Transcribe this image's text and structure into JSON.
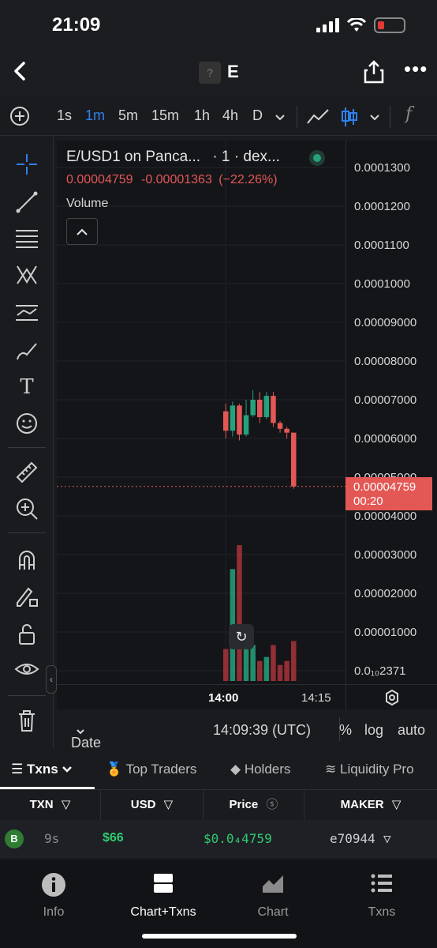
{
  "status_bar": {
    "time": "21:09"
  },
  "header": {
    "token_symbol": "E",
    "token_logo_placeholder": "?"
  },
  "toolbar": {
    "intervals": [
      "1s",
      "1m",
      "5m",
      "15m",
      "1h",
      "4h",
      "D"
    ],
    "active_interval": "1m",
    "function_label": "f"
  },
  "chart": {
    "pair_title": "E/USD1 on Panca...",
    "source_suffix": "· 1 · dex...",
    "last_price": "0.00004759",
    "change": "-0.00001363",
    "change_pct": "(−22.26%)",
    "volume_label": "Volume",
    "price_labels": [
      "0.0001300",
      "0.0001200",
      "0.0001100",
      "0.0001000",
      "0.00009000",
      "0.00008000",
      "0.00007000",
      "0.00006000",
      "0.00005000",
      "0.00004000",
      "0.00003000",
      "0.00002000",
      "0.00001000",
      "0.0₁₀2371"
    ],
    "current_price_tag": "0.00004759",
    "countdown": "00:20",
    "time_labels": [
      "14:00",
      "14:15"
    ],
    "date_range_label": "Date Range",
    "clock": "14:09:39 (UTC)",
    "percent_label": "%",
    "log_label": "log",
    "auto_label": "auto",
    "colors": {
      "up": "#26a17b",
      "down": "#e35855",
      "volume_up": "#26a17b",
      "volume_down": "#a8323a"
    }
  },
  "chart_data": {
    "type": "candlestick",
    "x": [
      "13:59",
      "14:00",
      "14:01",
      "14:02",
      "14:03",
      "14:04",
      "14:05",
      "14:06",
      "14:07",
      "14:08",
      "14:09"
    ],
    "candles": [
      {
        "open": 6.7e-05,
        "high": 6.9e-05,
        "low": 6e-05,
        "close": 6.2e-05
      },
      {
        "open": 6.2e-05,
        "high": 6.95e-05,
        "low": 6.05e-05,
        "close": 6.85e-05
      },
      {
        "open": 6.85e-05,
        "high": 6.9e-05,
        "low": 5.95e-05,
        "close": 6.1e-05
      },
      {
        "open": 6.1e-05,
        "high": 7e-05,
        "low": 6.05e-05,
        "close": 6.6e-05
      },
      {
        "open": 6.6e-05,
        "high": 7.25e-05,
        "low": 6.55e-05,
        "close": 7e-05
      },
      {
        "open": 7e-05,
        "high": 7.2e-05,
        "low": 6.4e-05,
        "close": 6.55e-05
      },
      {
        "open": 6.55e-05,
        "high": 7.2e-05,
        "low": 6.5e-05,
        "close": 7.1e-05
      },
      {
        "open": 7.1e-05,
        "high": 7.2e-05,
        "low": 6.3e-05,
        "close": 6.4e-05
      },
      {
        "open": 6.4e-05,
        "high": 6.45e-05,
        "low": 6.15e-05,
        "close": 6.25e-05
      },
      {
        "open": 6.25e-05,
        "high": 6.3e-05,
        "low": 6e-05,
        "close": 6.15e-05
      },
      {
        "open": 6.15e-05,
        "high": 6.15e-05,
        "low": 4.7e-05,
        "close": 4.76e-05
      }
    ],
    "volume": [
      8e-06,
      2.8e-05,
      3.4e-05,
      8e-06,
      9e-06,
      5e-06,
      6e-06,
      9e-06,
      4e-06,
      5e-06,
      1e-05
    ],
    "ylim": [
      2.37e-06,
      0.000135
    ]
  },
  "tabs": [
    {
      "label": "Txns",
      "active": true
    },
    {
      "label": "Top Traders",
      "active": false
    },
    {
      "label": "Holders",
      "active": false
    },
    {
      "label": "Liquidity Pro",
      "active": false
    }
  ],
  "table": {
    "headers": [
      "TXN",
      "USD",
      "Price",
      "MAKER"
    ],
    "rows": [
      {
        "type": "B",
        "age": "9s",
        "usd": "$66",
        "price": "$0.0₄4759",
        "maker": "e70944"
      }
    ]
  },
  "bottom_nav": [
    {
      "label": "Info",
      "icon": "info-icon",
      "active": false
    },
    {
      "label": "Chart+Txns",
      "icon": "chart-txns-icon",
      "active": true
    },
    {
      "label": "Chart",
      "icon": "chart-icon",
      "active": false
    },
    {
      "label": "Txns",
      "icon": "list-icon",
      "active": false
    }
  ]
}
